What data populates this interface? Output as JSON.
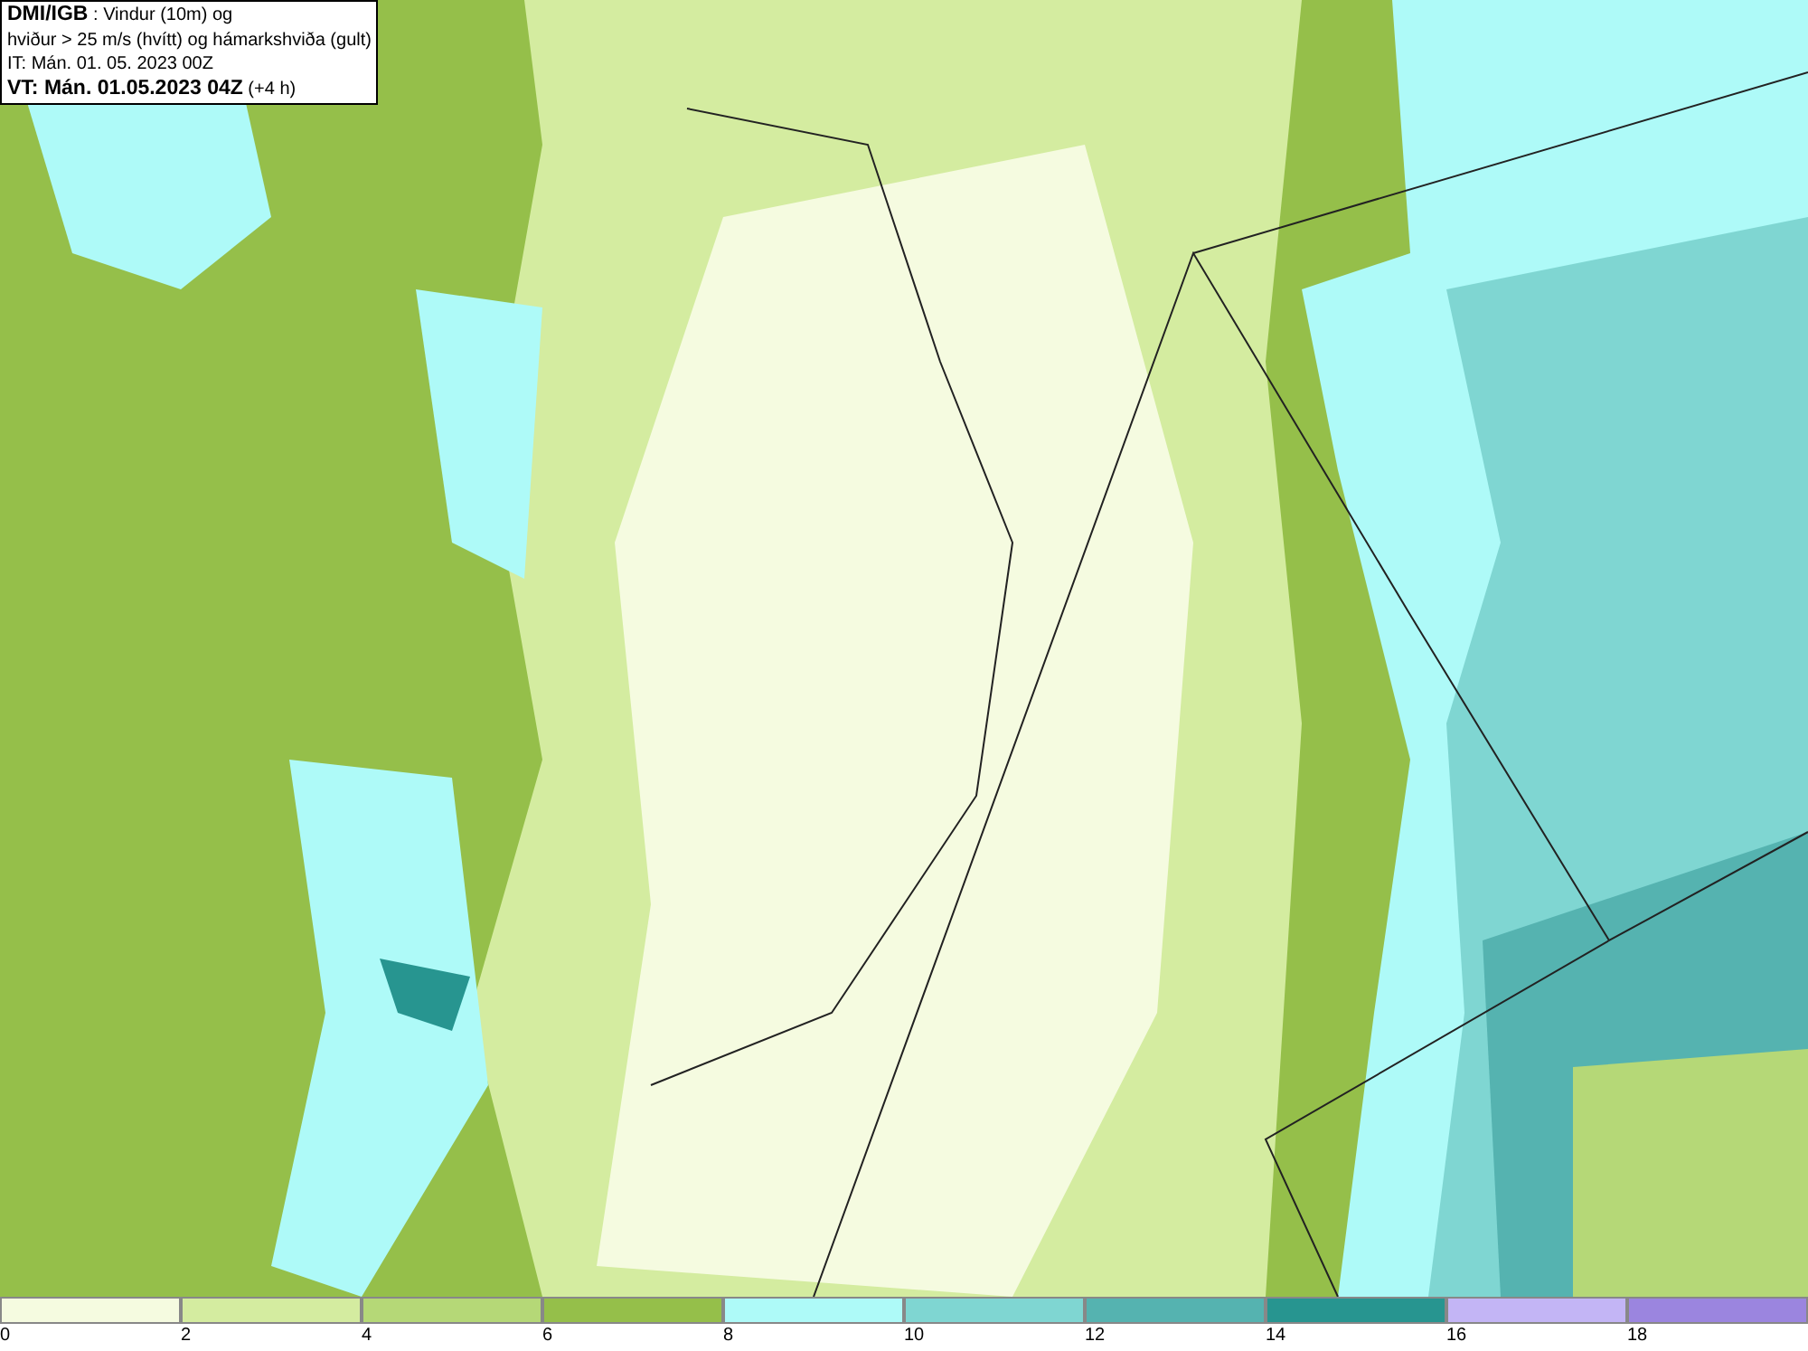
{
  "header": {
    "lines": [
      "**DMI/IGB** : Vindur (10m) og",
      "hviður > 25 m/s (hvítt) og hámarkshviða (gult)",
      "IT: Mán. 01. 05. 2023 00Z",
      "**VT: Mán. 01.05.2023 04Z** (+4 h)"
    ]
  },
  "legend": [
    {
      "label": "0",
      "color": "#f5fbe0"
    },
    {
      "label": "2",
      "color": "#d4eca0"
    },
    {
      "label": "4",
      "color": "#b5d877"
    },
    {
      "label": "6",
      "color": "#95bf4a"
    },
    {
      "label": "8",
      "color": "#aefaf8"
    },
    {
      "label": "10",
      "color": "#7fd6d2"
    },
    {
      "label": "12",
      "color": "#55b3b0"
    },
    {
      "label": "14",
      "color": "#279590"
    },
    {
      "label": "16",
      "color": "#c3b5f5"
    },
    {
      "label": "18",
      "color": "#9b85df"
    }
  ]
}
